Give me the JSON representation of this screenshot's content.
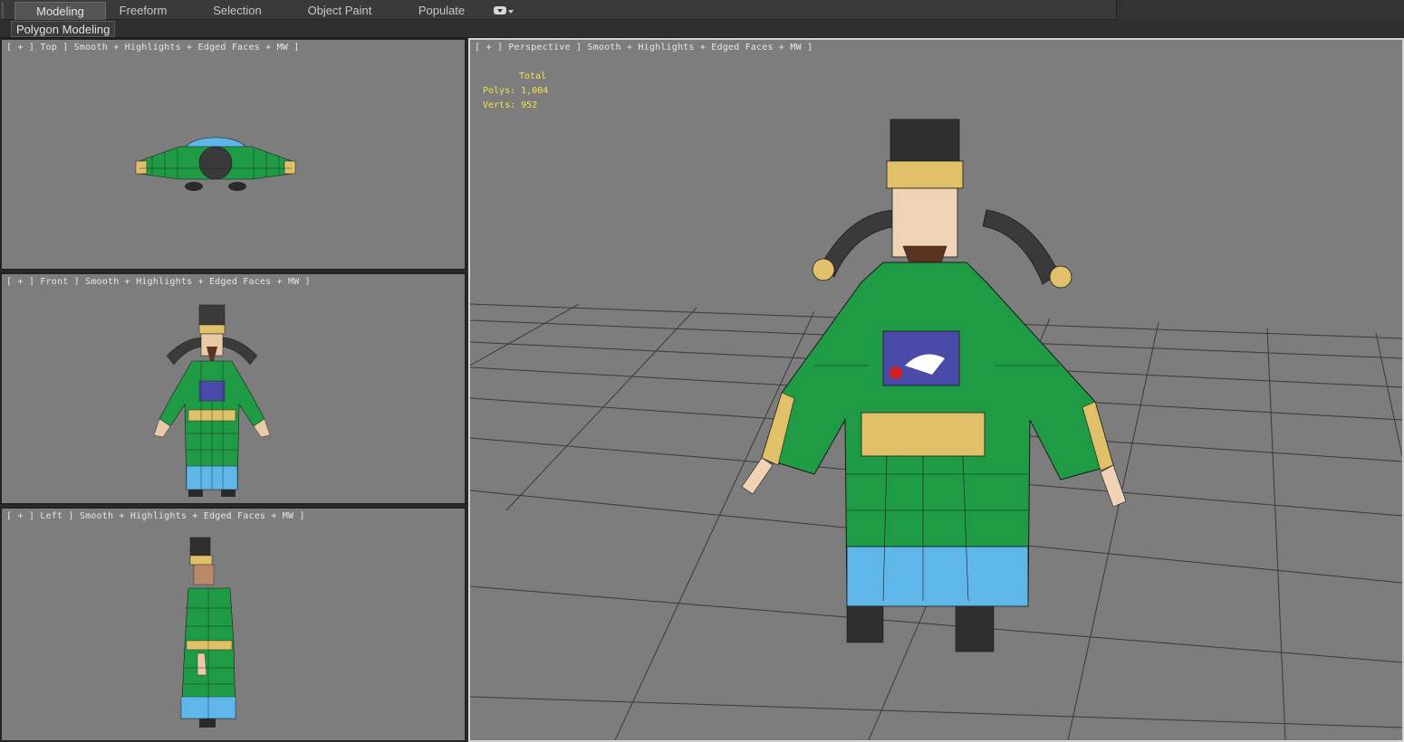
{
  "ribbon": {
    "tabs": [
      {
        "label": "Modeling",
        "active": true
      },
      {
        "label": "Freeform",
        "active": false
      },
      {
        "label": "Selection",
        "active": false
      },
      {
        "label": "Object Paint",
        "active": false
      },
      {
        "label": "Populate",
        "active": false
      }
    ],
    "panel_label": "Polygon Modeling"
  },
  "viewports": {
    "top": {
      "label": "[ + ] Top ] Smooth + Highlights + Edged Faces + MW ]"
    },
    "front": {
      "label": "[ + ] Front ] Smooth + Highlights + Edged Faces + MW ]"
    },
    "left": {
      "label": "[ + ] Left ] Smooth + Highlights + Edged Faces + MW ]"
    },
    "perspective": {
      "label": "[ + ] Perspective ] Smooth + Highlights + Edged Faces + MW ]",
      "stats": {
        "total_label": "Total",
        "polys": "Polys: 1,004",
        "verts": "Verts: 952"
      }
    }
  },
  "colors": {
    "viewport_bg": "#7d7d7d",
    "stats_text": "#f4e04a",
    "robe_green": "#1f9a45",
    "robe_trim_gold": "#e0c068",
    "robe_hem_blue": "#5fb6e8"
  }
}
